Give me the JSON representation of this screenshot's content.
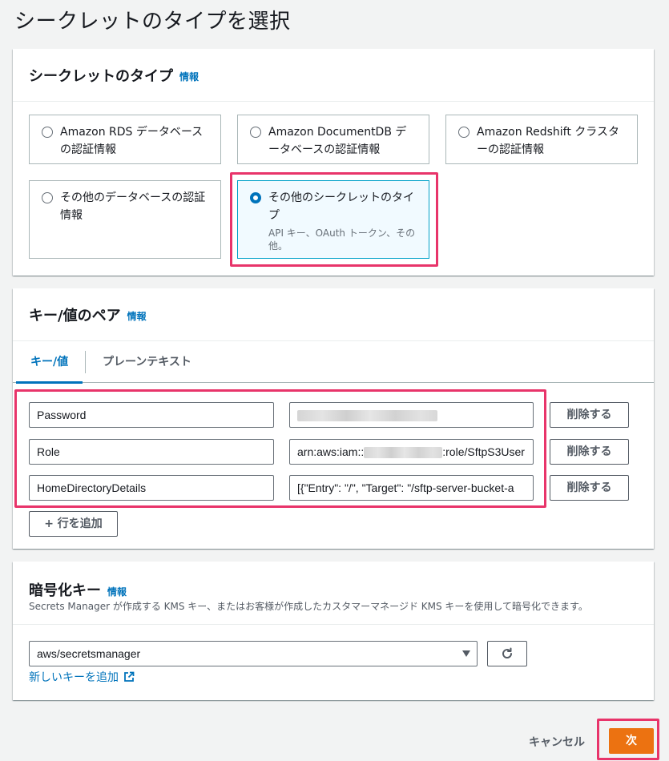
{
  "page_title": "シークレットのタイプを選択",
  "secret_type": {
    "title": "シークレットのタイプ",
    "info": "情報",
    "options": [
      {
        "label": "Amazon RDS データベースの認証情報",
        "selected": false
      },
      {
        "label": "Amazon DocumentDB データベースの認証情報",
        "selected": false
      },
      {
        "label": "Amazon Redshift クラスターの認証情報",
        "selected": false
      },
      {
        "label": "その他のデータベースの認証情報",
        "selected": false
      },
      {
        "label": "その他のシークレットのタイプ",
        "description": "API キー、OAuth トークン、その他。",
        "selected": true
      }
    ]
  },
  "key_value": {
    "title": "キー/値のペア",
    "info": "情報",
    "tabs": [
      {
        "label": "キー/値",
        "active": true
      },
      {
        "label": "プレーンテキスト",
        "active": false
      }
    ],
    "rows": [
      {
        "key": "Password",
        "value_redacted": true
      },
      {
        "key": "Role",
        "value_prefix": "arn:aws:iam::",
        "value_suffix": ":role/SftpS3User"
      },
      {
        "key": "HomeDirectoryDetails",
        "value": "[{\"Entry\": \"/\", \"Target\": \"/sftp-server-bucket-a"
      }
    ],
    "delete_label": "削除する",
    "add_row_label": "+ 行を追加"
  },
  "encryption": {
    "title": "暗号化キー",
    "info": "情報",
    "description": "Secrets Manager が作成する KMS キー、またはお客様が作成したカスタマーマネージド KMS キーを使用して暗号化できます。",
    "selected_key": "aws/secretsmanager",
    "new_key_link": "新しいキーを追加"
  },
  "footer": {
    "cancel_label": "キャンセル",
    "next_label": "次"
  },
  "colors": {
    "primary": "#ec7211",
    "link": "#0073bb",
    "highlight": "#e8346a"
  }
}
